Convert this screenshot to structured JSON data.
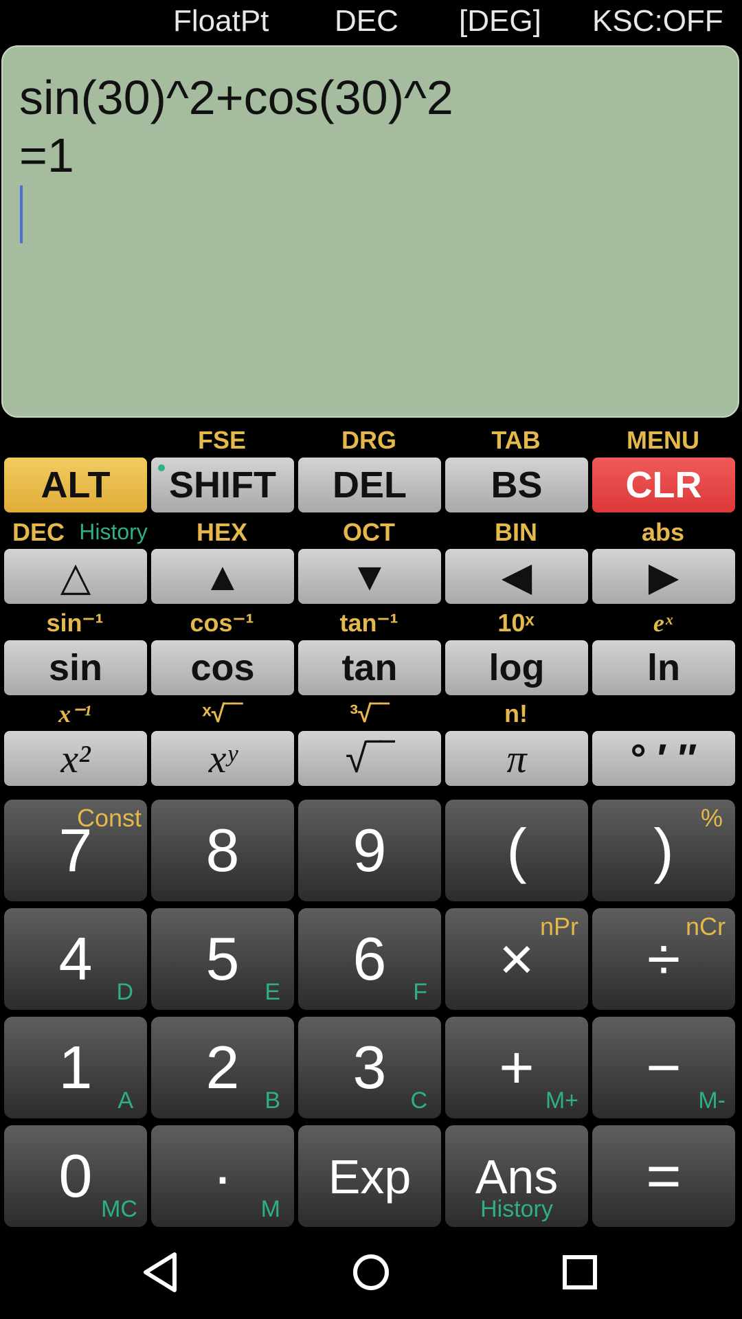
{
  "status": {
    "float": "FloatPt",
    "base": "DEC",
    "angle": "[DEG]",
    "ksc": "KSC:OFF"
  },
  "display": {
    "expression": "sin(30)^2+cos(30)^2",
    "result": "=1"
  },
  "row1": {
    "labels": {
      "shift": "FSE",
      "del": "DRG",
      "bs": "TAB",
      "clr": "MENU"
    },
    "keys": {
      "alt": "ALT",
      "shift": "SHIFT",
      "del": "DEL",
      "bs": "BS",
      "clr": "CLR"
    }
  },
  "row2": {
    "labels": {
      "dec": "DEC",
      "history": "History",
      "hex": "HEX",
      "oct": "OCT",
      "bin": "BIN",
      "abs": "abs"
    },
    "keys": {
      "k1": "△",
      "k2": "▲",
      "k3": "▼",
      "k4": "◀",
      "k5": "▶"
    }
  },
  "row3": {
    "labels": {
      "asin": "sin⁻¹",
      "acos": "cos⁻¹",
      "atan": "tan⁻¹",
      "pow10": "10ˣ",
      "exp": "eˣ"
    },
    "keys": {
      "sin": "sin",
      "cos": "cos",
      "tan": "tan",
      "log": "log",
      "ln": "ln"
    }
  },
  "row4": {
    "labels": {
      "inv": "x⁻¹",
      "xroot": "ˣ√‾‾",
      "croot": "³√‾‾",
      "fact": "n!"
    },
    "keys": {
      "sq": "x²",
      "pow": "xʸ",
      "sqrt": "√‾‾",
      "pi": "π",
      "dms": "° ′ ″"
    }
  },
  "keypad": {
    "seven": {
      "main": "7",
      "sup": "Const"
    },
    "eight": {
      "main": "8"
    },
    "nine": {
      "main": "9"
    },
    "lparen": {
      "main": "("
    },
    "rparen": {
      "main": ")",
      "sup": "%"
    },
    "four": {
      "main": "4",
      "sub": "D"
    },
    "five": {
      "main": "5",
      "sub": "E"
    },
    "six": {
      "main": "6",
      "sub": "F"
    },
    "mul": {
      "main": "×",
      "sup": "nPr"
    },
    "div": {
      "main": "÷",
      "sup": "nCr"
    },
    "one": {
      "main": "1",
      "sub": "A"
    },
    "two": {
      "main": "2",
      "sub": "B"
    },
    "three": {
      "main": "3",
      "sub": "C"
    },
    "plus": {
      "main": "+",
      "sub": "M+"
    },
    "minus": {
      "main": "−",
      "sub": "M-"
    },
    "zero": {
      "main": "0",
      "sub": "MC"
    },
    "dot": {
      "main": "·",
      "sub": "M"
    },
    "exp": {
      "main": "Exp"
    },
    "ans": {
      "main": "Ans",
      "sub": "History"
    },
    "equals": {
      "main": "="
    }
  }
}
